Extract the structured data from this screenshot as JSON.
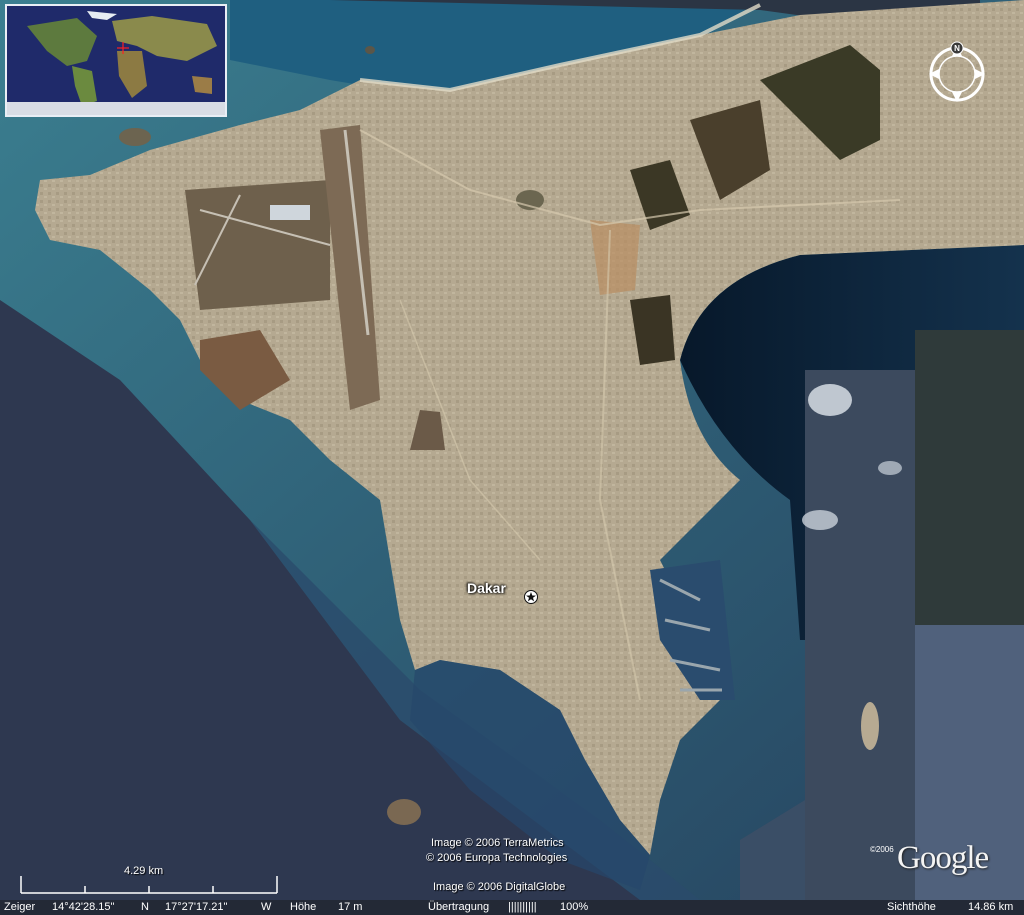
{
  "map": {
    "place_label": "Dakar",
    "view": "satellite",
    "icons": {
      "compass": "compass-north-icon",
      "place_marker": "star-marker-icon",
      "overview_crosshair": "crosshair-icon"
    },
    "compass_letter": "N"
  },
  "credits": {
    "line1": "Image © 2006 TerraMetrics",
    "line2": "© 2006 Europa Technologies",
    "line3": "Image © 2006 DigitalGlobe",
    "logo_year": "©2006",
    "logo": "Google"
  },
  "scale": {
    "label": "4.29 km"
  },
  "status": {
    "pointer_label": "Zeiger",
    "latitude": "14°42'28.15\"",
    "lat_hemisphere": "N",
    "longitude": "17°27'17.21\"",
    "lon_hemisphere": "W",
    "elevation_label": "Höhe",
    "elevation": "17 m",
    "streaming_label": "Übertragung",
    "streaming_bar": "||||||||||",
    "streaming_value": "100%",
    "eye_alt_label": "Sichthöhe",
    "eye_alt": "14.86 km"
  },
  "colors": {
    "ocean_deep": "#2c3650",
    "ocean_shallow": "#3d7589",
    "bay_dark": "#0d1f36",
    "land": "#b0a48c",
    "dry_land": "#8a735a",
    "vegetation": "#3f3a26"
  }
}
